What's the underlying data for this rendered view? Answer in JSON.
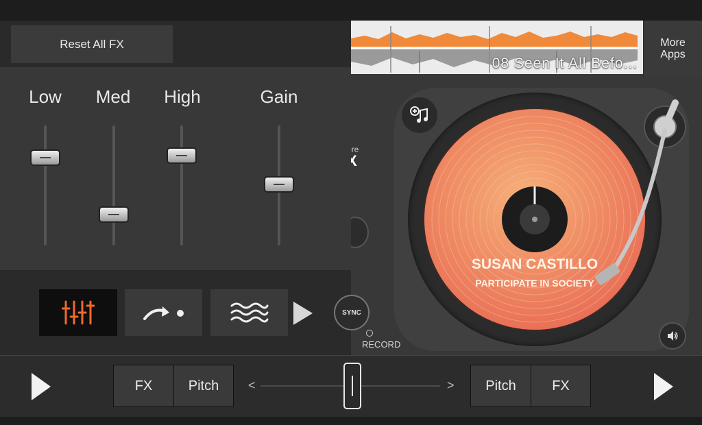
{
  "fx_panel": {
    "reset_label": "Reset All FX",
    "eq": [
      {
        "label": "Low",
        "level": 0.73
      },
      {
        "label": "Med",
        "level": 0.26
      },
      {
        "label": "High",
        "level": 0.75
      },
      {
        "label": "Gain",
        "level": 0.51
      }
    ],
    "modes": [
      {
        "name": "eq-mode",
        "icon": "eq-sliders-icon",
        "active": true
      },
      {
        "name": "loop-mode",
        "icon": "curved-arrow-dot-icon",
        "active": false
      },
      {
        "name": "filter-mode",
        "icon": "waves-icon",
        "active": false
      }
    ]
  },
  "deck": {
    "track_title": "08 Seen It All Befo...",
    "more_apps_line1": "More",
    "more_apps_line2": "Apps",
    "more_fx_line1": "ore",
    "more_fx_line2": "X",
    "sync_label": "SYNC",
    "record_label": "RECORD",
    "artist": "SUSAN CASTILLO",
    "album": "PARTICIPATE IN SOCIETY",
    "accent_color": "#f08a3a"
  },
  "bottom": {
    "left_fx": "FX",
    "left_pitch": "Pitch",
    "right_pitch": "Pitch",
    "right_fx": "FX",
    "xfader_left_arrow": "<",
    "xfader_right_arrow": ">",
    "crossfader_position": 0.5
  }
}
